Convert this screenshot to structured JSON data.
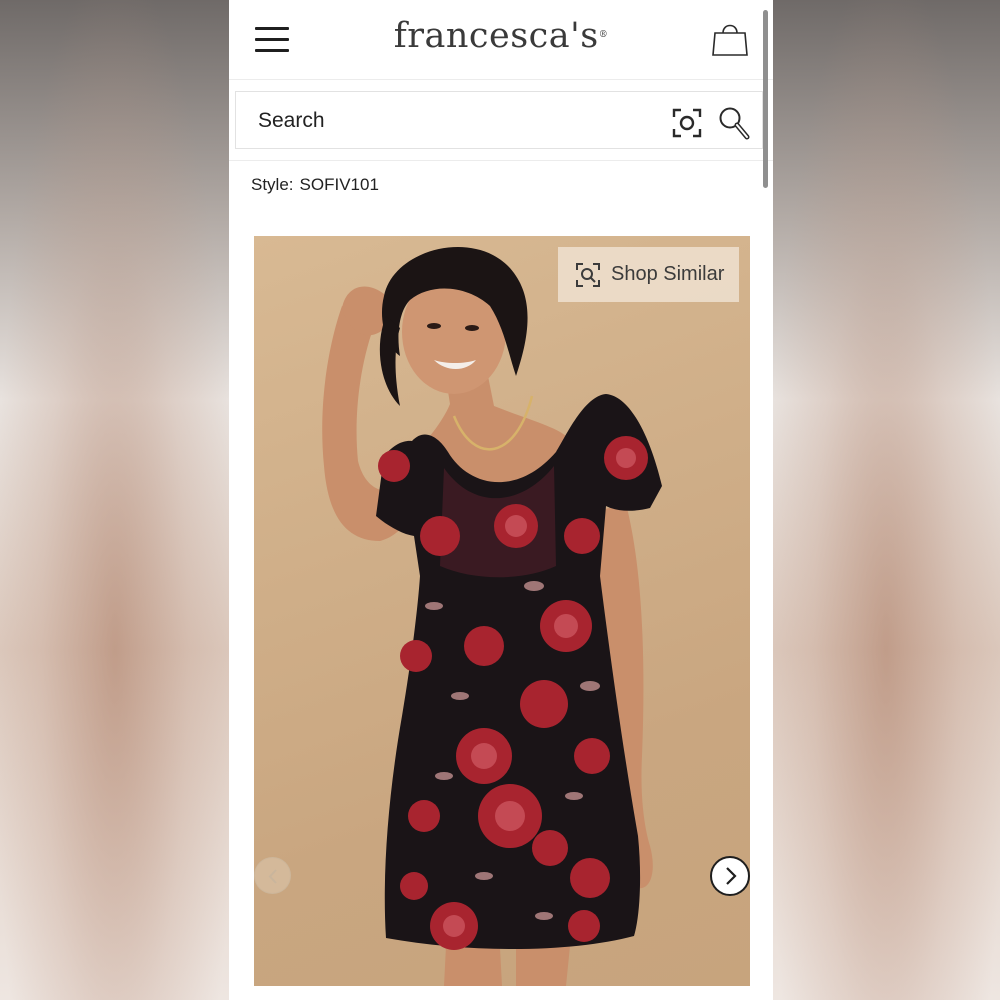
{
  "header": {
    "logo": "francesca's",
    "logo_mark": "®",
    "menu_icon": "hamburger-menu-icon",
    "bag_icon": "shopping-bag-icon"
  },
  "search": {
    "placeholder": "Search",
    "camera_icon": "visual-search-camera-icon",
    "search_icon": "magnifier-icon"
  },
  "product": {
    "style_label": "Style:",
    "style_code": "SOFIV101",
    "image_description_icon": "product-photo",
    "shop_similar_label": "Shop Similar",
    "shop_similar_icon": "visual-search-icon",
    "prev_icon": "chevron-left-icon",
    "next_icon": "chevron-right-icon"
  },
  "colors": {
    "accent_dark": "#1e1e1e",
    "photo_background": "#cfae88",
    "dress_base": "#1a1417",
    "dress_flower": "#a8242f"
  }
}
